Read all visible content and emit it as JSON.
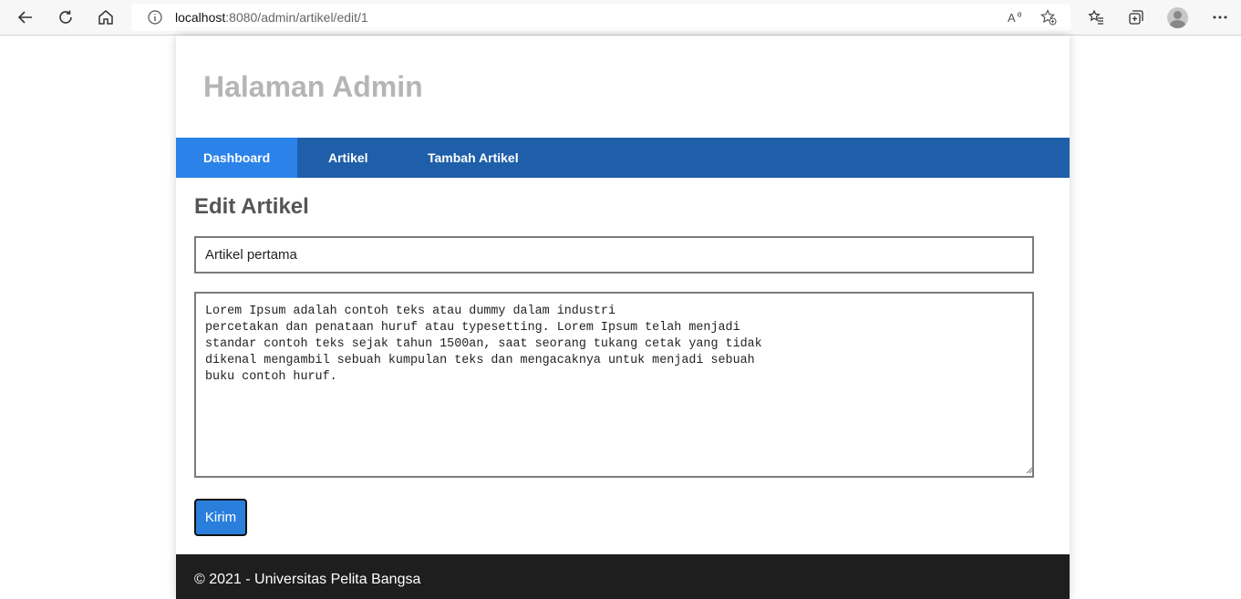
{
  "browser": {
    "url_host": "localhost",
    "url_path": ":8080/admin/artikel/edit/1"
  },
  "header": {
    "title": "Halaman Admin"
  },
  "nav": {
    "items": [
      {
        "label": "Dashboard",
        "active": true
      },
      {
        "label": "Artikel",
        "active": false
      },
      {
        "label": "Tambah Artikel",
        "active": false
      }
    ]
  },
  "form": {
    "heading": "Edit Artikel",
    "title_value": "Artikel pertama",
    "body_value": "Lorem Ipsum adalah contoh teks atau dummy dalam industri\npercetakan dan penataan huruf atau typesetting. Lorem Ipsum telah menjadi\nstandar contoh teks sejak tahun 1500an, saat seorang tukang cetak yang tidak\ndikenal mengambil sebuah kumpulan teks dan mengacaknya untuk menjadi sebuah\nbuku contoh huruf.",
    "submit_label": "Kirim"
  },
  "footer": {
    "text": "© 2021 - Universitas Pelita Bangsa"
  },
  "colors": {
    "nav_bg": "#1f5faa",
    "nav_active": "#2b83ea",
    "button_bg": "#2b7fdc",
    "footer_bg": "#1e1e1e",
    "header_text": "#b5b5b5"
  }
}
